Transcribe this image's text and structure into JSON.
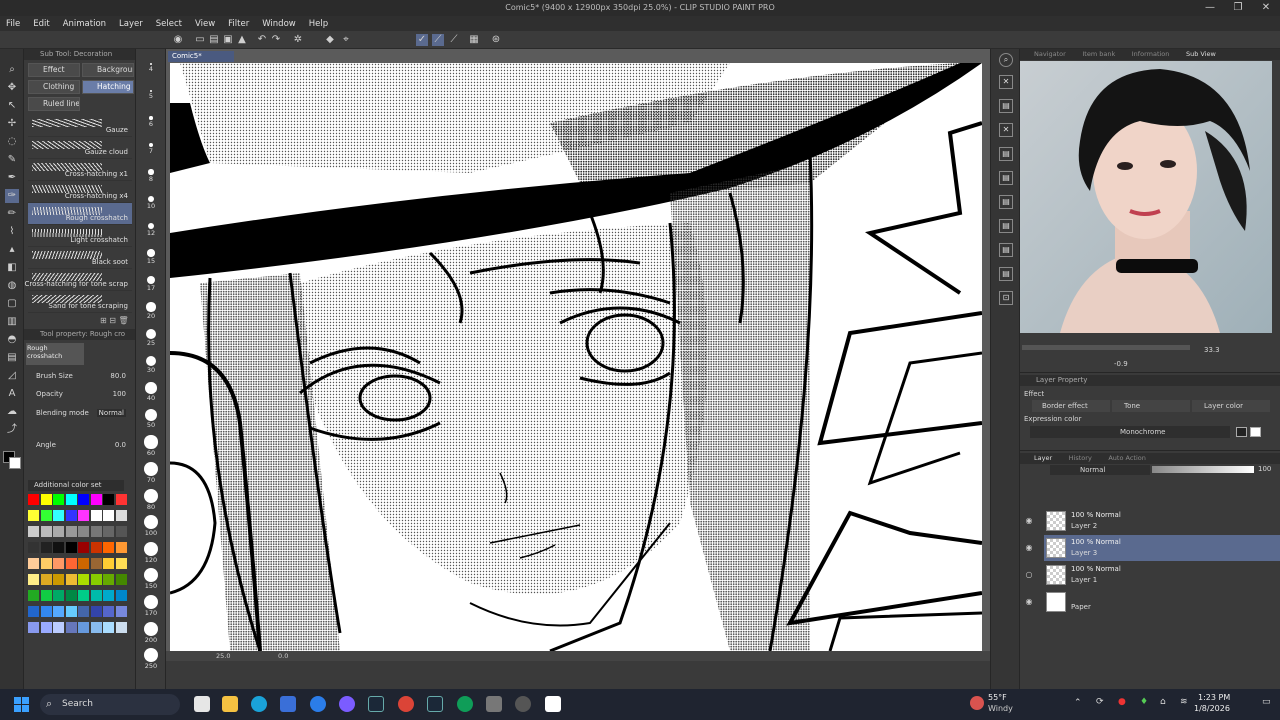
{
  "window": {
    "title": "Comic5* (9400 x 12900px 350dpi 25.0%) - CLIP STUDIO PAINT PRO",
    "controls": [
      "—",
      "❐",
      "✕"
    ]
  },
  "menu": [
    "File",
    "Edit",
    "Animation",
    "Layer",
    "Select",
    "View",
    "Filter",
    "Window",
    "Help"
  ],
  "subtool": {
    "header": "Sub Tool: Decoration",
    "categories": [
      {
        "label": "Effect",
        "selected": false
      },
      {
        "label": "Backgroun",
        "selected": false
      },
      {
        "label": "Clothing",
        "selected": false
      },
      {
        "label": "Hatching o",
        "selected": true
      },
      {
        "label": "Ruled line",
        "selected": false
      }
    ],
    "brushes": [
      {
        "label": "Gauze",
        "selected": false
      },
      {
        "label": "Gauze cloud",
        "selected": false
      },
      {
        "label": "Cross-hatching x1",
        "selected": false
      },
      {
        "label": "Cross-hatching x4",
        "selected": false
      },
      {
        "label": "Rough crosshatch",
        "selected": true
      },
      {
        "label": "Light crosshatch",
        "selected": false
      },
      {
        "label": "Black soot",
        "selected": false
      },
      {
        "label": "Cross-hatching for tone scrap",
        "selected": false
      },
      {
        "label": "Sand for tone scraping",
        "selected": false
      }
    ]
  },
  "toolprop": {
    "header": "Tool property: Rough cro",
    "name": "Rough crosshatch",
    "brush_size_label": "Brush Size",
    "brush_size": "80.0",
    "opacity_label": "Opacity",
    "opacity": "100",
    "blending_label": "Blending mode",
    "blending": "Normal",
    "angle_label": "Angle",
    "angle": "0.0"
  },
  "colorset": {
    "name": "Additional color set"
  },
  "brush_sizes": [
    "4",
    "5",
    "6",
    "7",
    "8",
    "10",
    "12",
    "15",
    "17",
    "20",
    "25",
    "30",
    "40",
    "50",
    "60",
    "70",
    "80",
    "100",
    "120",
    "150",
    "170",
    "200",
    "250"
  ],
  "canvas": {
    "tab": "Comic5*",
    "zoom": "25.0",
    "angle": "0.0"
  },
  "subview": {
    "tabs": [
      {
        "label": "Navigator",
        "on": false
      },
      {
        "label": "Item bank",
        "on": false
      },
      {
        "label": "Information",
        "on": false
      },
      {
        "label": "Sub View",
        "on": true
      }
    ],
    "zoom": "33.3",
    "rotate": "-0.9"
  },
  "layer_property": {
    "title": "Layer Property",
    "effect_label": "Effect",
    "border_effect": "Border effect",
    "tone": "Tone",
    "layer_color": "Layer color",
    "expression_color_label": "Expression color",
    "expression_color": "Monochrome"
  },
  "layers_panel": {
    "tabs": [
      "Layer",
      "History",
      "Auto Action"
    ],
    "blend": "Normal",
    "opacity": "100",
    "items": [
      {
        "mode": "100 % Normal",
        "name": "Layer 2",
        "selected": false,
        "visible": true
      },
      {
        "mode": "100 % Normal",
        "name": "Layer 3",
        "selected": true,
        "visible": true
      },
      {
        "mode": "100 % Normal",
        "name": "Layer 1",
        "selected": false,
        "visible": false
      },
      {
        "mode": "",
        "name": "Paper",
        "selected": false,
        "visible": true
      }
    ]
  },
  "taskbar": {
    "search": "Search",
    "weather_temp": "55°F",
    "weather_desc": "Windy",
    "time": "1:23 PM",
    "date": "1/8/2026"
  },
  "colors": {
    "accent": "#5a6a8f",
    "panel": "#3a3a3a",
    "taskbar": "#1f2430"
  }
}
